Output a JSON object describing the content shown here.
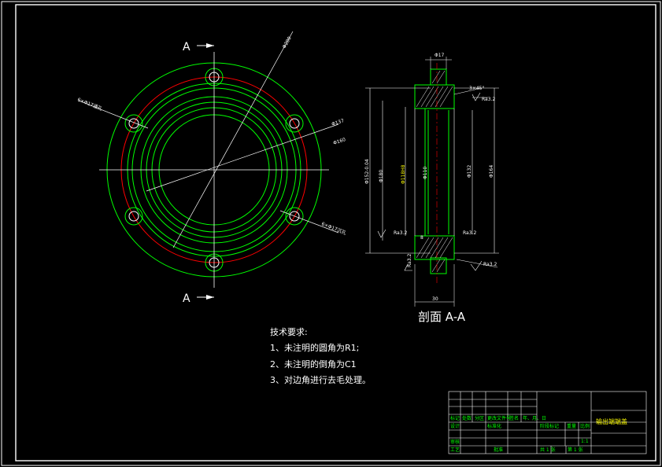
{
  "plan_view": {
    "section_mark_letter": "A",
    "dim_outer_dia": "Φ200",
    "dim_d1": "Φ137",
    "dim_d2": "Φ160",
    "hole_note_left": "6×Φ17通孔",
    "hole_note_right": "6×Φ17沉孔"
  },
  "section_view": {
    "title": "剖面 A-A",
    "dim_top_width": "Φ17",
    "dim_chamfer": "3×45°",
    "dim_left_1": "Φ152-0.04",
    "dim_left_2": "Φ180",
    "dim_center_yellow": "Φ118H8",
    "dim_center_1": "Φ110",
    "dim_right_1": "Φ132",
    "dim_right_2": "Φ164",
    "rough_1": "Ra3.2",
    "rough_2": "Ra3.2",
    "rough_3": "Ra3.2",
    "rough_4": "Ra3.2",
    "rough_5": "Ra3.2",
    "dim_bottom": "30",
    "dim_small": "8"
  },
  "tech_requirements": {
    "heading": "技术要求:",
    "line1": "1、未注明的圆角为R1;",
    "line2": "2、未注明的倒角为C1",
    "line3": "3、对边角进行去毛处理。"
  },
  "title_block": {
    "part_name": "输出端端盖",
    "cells": [
      "标记",
      "处数",
      "分区",
      "更改文件号",
      "签名",
      "年、月、日",
      "设计",
      "标准化",
      "阶段标记",
      "重量",
      "比例",
      "审核",
      "工艺",
      "批准",
      "1:1",
      "共 1 张",
      "第 1 张"
    ]
  },
  "colors": {
    "outline": "#00ff00",
    "center_line": "#ff0000",
    "annotation": "#ffffff",
    "highlight": "#ffff00"
  }
}
